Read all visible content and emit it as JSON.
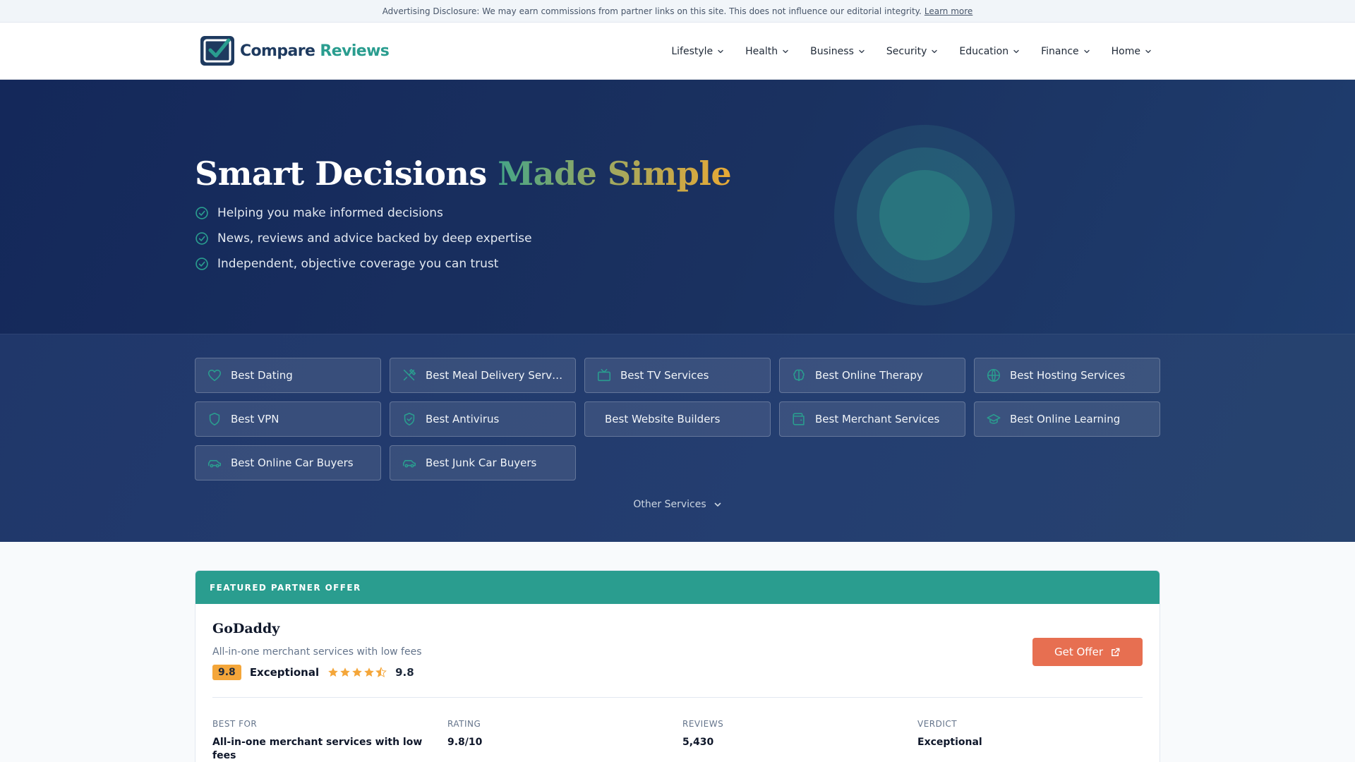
{
  "disclosure": {
    "text": "Advertising Disclosure: We may earn commissions from partner links on this site. This does not influence our editorial integrity.",
    "link": "Learn more"
  },
  "logo": {
    "part1": "Compare",
    "part2": "Reviews"
  },
  "nav": [
    {
      "label": "Lifestyle"
    },
    {
      "label": "Health"
    },
    {
      "label": "Business"
    },
    {
      "label": "Security"
    },
    {
      "label": "Education"
    },
    {
      "label": "Finance"
    },
    {
      "label": "Home"
    }
  ],
  "hero": {
    "title_main": "Smart Decisions ",
    "title_accent": "Made Simple",
    "bullets": [
      "Helping you make informed decisions",
      "News, reviews and advice backed by deep expertise",
      "Independent, objective coverage you can trust"
    ]
  },
  "services": [
    {
      "label": "Best Dating",
      "icon": "heart-icon"
    },
    {
      "label": "Best Meal Delivery Services",
      "icon": "utensils-icon"
    },
    {
      "label": "Best TV Services",
      "icon": "tv-icon"
    },
    {
      "label": "Best Online Therapy",
      "icon": "brain-icon"
    },
    {
      "label": "Best Hosting Services",
      "icon": "globe-icon"
    },
    {
      "label": "Best VPN",
      "icon": "shield-icon"
    },
    {
      "label": "Best Antivirus",
      "icon": "shield-check-icon"
    },
    {
      "label": "Best Website Builders",
      "icon": ""
    },
    {
      "label": "Best Merchant Services",
      "icon": "wallet-icon"
    },
    {
      "label": "Best Online Learning",
      "icon": "graduation-cap-icon"
    },
    {
      "label": "Best Online Car Buyers",
      "icon": "car-icon"
    },
    {
      "label": "Best Junk Car Buyers",
      "icon": "car-icon"
    }
  ],
  "other_services": "Other Services",
  "featured": {
    "header": "FEATURED PARTNER OFFER",
    "brand": "GoDaddy",
    "tagline": "All-in-one merchant services with low fees",
    "score": "9.8",
    "verdict": "Exceptional",
    "stars": 4.5,
    "star_score": "9.8",
    "cta": "Get Offer",
    "stats": [
      {
        "label": "BEST FOR",
        "value": "All-in-one merchant services with low fees"
      },
      {
        "label": "RATING",
        "value": "9.8/10"
      },
      {
        "label": "REVIEWS",
        "value": "5,430"
      },
      {
        "label": "VERDICT",
        "value": "Exceptional"
      }
    ]
  },
  "colors": {
    "navy": "#1e3a5f",
    "teal": "#2a9d8f",
    "accent_orange": "#e76f51",
    "badge_amber": "#f4a63a",
    "star": "#f4a63a"
  }
}
